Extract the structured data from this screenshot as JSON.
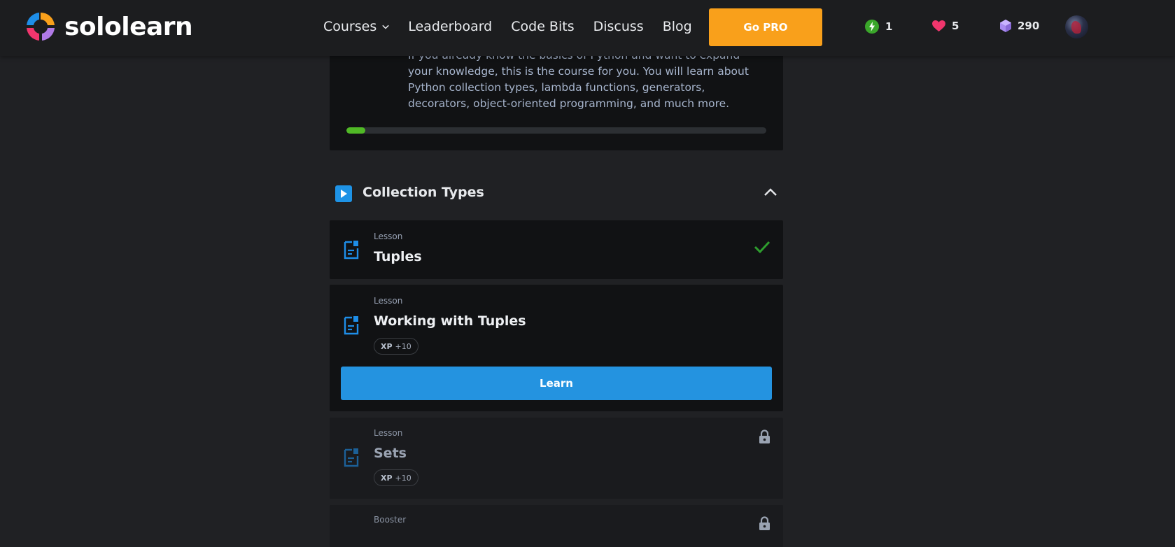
{
  "header": {
    "brand": "sololearn",
    "nav": [
      {
        "label": "Courses",
        "has_dropdown": true
      },
      {
        "label": "Leaderboard"
      },
      {
        "label": "Code Bits"
      },
      {
        "label": "Discuss"
      },
      {
        "label": "Blog"
      }
    ],
    "go_pro_label": "Go PRO",
    "stats": {
      "streak": {
        "icon": "lightning-icon",
        "value": "1",
        "color": "#3aa62a"
      },
      "hearts": {
        "icon": "heart-icon",
        "value": "5",
        "color": "#f0366d"
      },
      "gems": {
        "icon": "gem-icon",
        "value": "290",
        "color": "#a98bf0"
      }
    }
  },
  "course": {
    "description": "If you already know the basics of Python and want to expand your knowledge, this is the course for you. You will learn about Python collection types, lambda functions, generators, decorators, object-oriented programming, and much more.",
    "progress_fraction": 0.045
  },
  "module": {
    "title": "Collection Types",
    "lessons": [
      {
        "kind": "Lesson",
        "title": "Tuples",
        "status": "completed"
      },
      {
        "kind": "Lesson",
        "title": "Working with Tuples",
        "xp_label": "XP",
        "xp_value": "+10",
        "status": "current",
        "action_label": "Learn"
      },
      {
        "kind": "Lesson",
        "title": "Sets",
        "xp_label": "XP",
        "xp_value": "+10",
        "status": "locked"
      },
      {
        "kind": "Booster",
        "status": "locked"
      }
    ]
  },
  "colors": {
    "accent_blue": "#2493e0",
    "go_pro_orange": "#f9a01b",
    "progress_green": "#50b926",
    "check_green": "#2e9e2e"
  }
}
